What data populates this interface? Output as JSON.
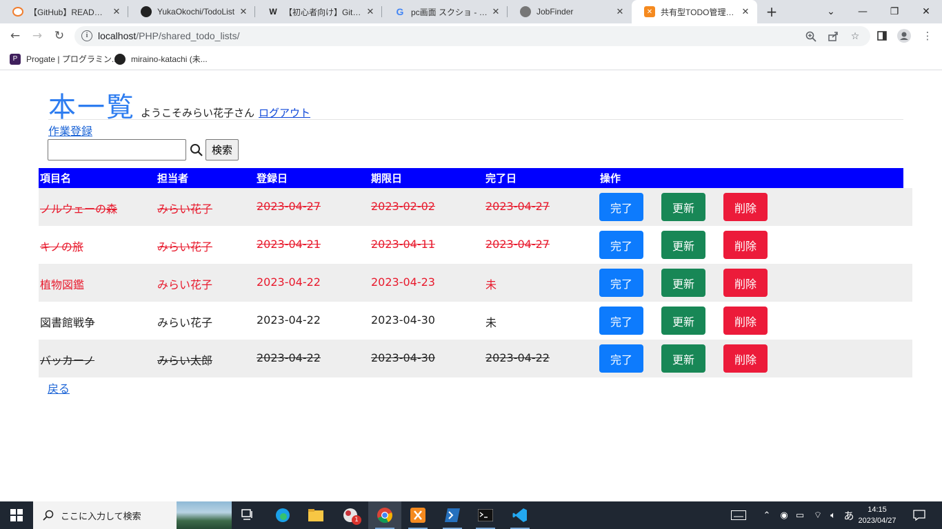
{
  "browser": {
    "tabs": [
      {
        "title": "【GitHub】READMEって何",
        "icon": "readme-favicon"
      },
      {
        "title": "YukaOkochi/TodoList",
        "icon": "github-favicon"
      },
      {
        "title": "【初心者向け】GitHubの",
        "icon": "w-favicon"
      },
      {
        "title": "pc画面 スクショ - Goog",
        "icon": "google-favicon"
      },
      {
        "title": "JobFinder",
        "icon": "globe-favicon"
      },
      {
        "title": "共有型TODO管理アプリ",
        "icon": "xampp-favicon"
      }
    ],
    "url_host": "localhost",
    "url_path": "/PHP/shared_todo_lists/",
    "bookmarks": [
      {
        "label": "Progate | プログラミン...",
        "icon": "progate-favicon"
      },
      {
        "label": "miraino-katachi (未...",
        "icon": "github-favicon"
      }
    ]
  },
  "page": {
    "title": "本一覧",
    "welcome": "ようこそみらい花子さん",
    "logout": "ログアウト",
    "register_link": "作業登録",
    "search_value": "",
    "search_button": "検索",
    "back_link": "戻る"
  },
  "table": {
    "headers": [
      "項目名",
      "担当者",
      "登録日",
      "期限日",
      "完了日",
      "操作"
    ],
    "complete_label": "完了",
    "update_label": "更新",
    "delete_label": "削除",
    "rows": [
      {
        "item": "ノルウェーの森",
        "assignee": "みらい花子",
        "registered": "2023-04-27",
        "deadline": "2023-02-02",
        "completed": "2023-04-27",
        "status": "overdue-done"
      },
      {
        "item": "キノの旅",
        "assignee": "みらい花子",
        "registered": "2023-04-21",
        "deadline": "2023-04-11",
        "completed": "2023-04-27",
        "status": "overdue-done"
      },
      {
        "item": "植物図鑑",
        "assignee": "みらい花子",
        "registered": "2023-04-22",
        "deadline": "2023-04-23",
        "completed": "未",
        "status": "overdue"
      },
      {
        "item": "図書館戦争",
        "assignee": "みらい花子",
        "registered": "2023-04-22",
        "deadline": "2023-04-30",
        "completed": "未",
        "status": "normal"
      },
      {
        "item": "バッカーノ",
        "assignee": "みらい太郎",
        "registered": "2023-04-22",
        "deadline": "2023-04-30",
        "completed": "2023-04-22",
        "status": "done"
      }
    ]
  },
  "taskbar": {
    "search_placeholder": "ここに入力して検索",
    "ime": "あ",
    "time": "14:15",
    "date": "2023/04/27",
    "badge": "1"
  },
  "colors": {
    "header_bg": "#0000ff",
    "overdue_text": "#e8192c",
    "complete_btn": "#0d7bfd",
    "update_btn": "#188756",
    "delete_btn": "#ec1b3a",
    "title": "#2e7df0"
  }
}
